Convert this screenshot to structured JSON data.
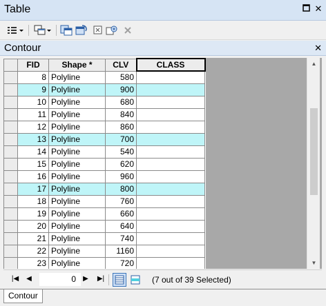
{
  "window": {
    "title": "Table"
  },
  "toolbar": {
    "buttons": [
      "table-options-icon",
      "related-tables-icon",
      "select-by-attributes-icon",
      "switch-selection-icon",
      "clear-selection-icon",
      "zoom-to-selected-icon",
      "delete-selected-icon"
    ]
  },
  "tab": {
    "name": "Contour"
  },
  "table": {
    "columns": [
      "FID",
      "Shape *",
      "CLV",
      "CLASS"
    ],
    "rows": [
      {
        "fid": "8",
        "shape": "Polyline",
        "clv": "580",
        "cls": "",
        "selected": false
      },
      {
        "fid": "9",
        "shape": "Polyline",
        "clv": "900",
        "cls": "",
        "selected": true
      },
      {
        "fid": "10",
        "shape": "Polyline",
        "clv": "680",
        "cls": "",
        "selected": false
      },
      {
        "fid": "11",
        "shape": "Polyline",
        "clv": "840",
        "cls": "",
        "selected": false
      },
      {
        "fid": "12",
        "shape": "Polyline",
        "clv": "860",
        "cls": "",
        "selected": false
      },
      {
        "fid": "13",
        "shape": "Polyline",
        "clv": "700",
        "cls": "",
        "selected": true
      },
      {
        "fid": "14",
        "shape": "Polyline",
        "clv": "540",
        "cls": "",
        "selected": false
      },
      {
        "fid": "15",
        "shape": "Polyline",
        "clv": "620",
        "cls": "",
        "selected": false
      },
      {
        "fid": "16",
        "shape": "Polyline",
        "clv": "960",
        "cls": "",
        "selected": false
      },
      {
        "fid": "17",
        "shape": "Polyline",
        "clv": "800",
        "cls": "",
        "selected": true
      },
      {
        "fid": "18",
        "shape": "Polyline",
        "clv": "760",
        "cls": "",
        "selected": false
      },
      {
        "fid": "19",
        "shape": "Polyline",
        "clv": "660",
        "cls": "",
        "selected": false
      },
      {
        "fid": "20",
        "shape": "Polyline",
        "clv": "640",
        "cls": "",
        "selected": false
      },
      {
        "fid": "21",
        "shape": "Polyline",
        "clv": "740",
        "cls": "",
        "selected": false
      },
      {
        "fid": "22",
        "shape": "Polyline",
        "clv": "1160",
        "cls": "",
        "selected": false
      },
      {
        "fid": "23",
        "shape": "Polyline",
        "clv": "720",
        "cls": "",
        "selected": false
      }
    ]
  },
  "navigation": {
    "current_record": "0",
    "status": "(7 out of 39 Selected)"
  },
  "bottom_tab": {
    "label": "Contour"
  },
  "colors": {
    "selected_row": "#bff5f8",
    "titlebar": "#d6e4f4"
  }
}
